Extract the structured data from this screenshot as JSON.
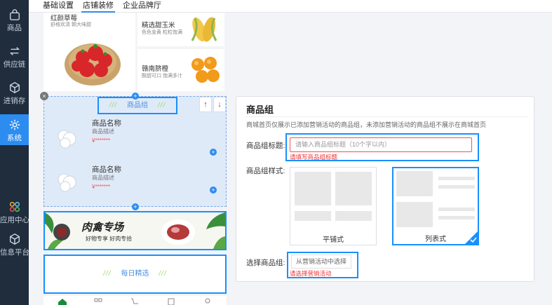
{
  "sidebar": {
    "items": [
      {
        "label": "商品",
        "icon": "shopping-bag-icon"
      },
      {
        "label": "供应链",
        "icon": "exchange-icon"
      },
      {
        "label": "进销存",
        "icon": "inventory-icon"
      },
      {
        "label": "系统",
        "icon": "gear-icon"
      },
      {
        "label": "应用中心",
        "icon": "apps-icon"
      },
      {
        "label": "信息平台",
        "icon": "cube-icon"
      }
    ]
  },
  "tabs": [
    "基础设置",
    "店铺装修",
    "企业品牌厅"
  ],
  "preview": {
    "fruit_left": {
      "name": "红颜草莓",
      "desc": "舒格欢清 颗大味甜"
    },
    "fruit_r1": {
      "name": "精选甜玉米",
      "desc": "色色金黄 粒粒饱满"
    },
    "fruit_r2": {
      "name": "赣南脐橙",
      "desc": "酸甜可口 饱满多汁"
    },
    "goods_group_title": "商品组",
    "deco": "///",
    "items": [
      {
        "name": "商品名称",
        "desc": "商品描述",
        "price": "¥*******"
      },
      {
        "name": "商品名称",
        "desc": "商品描述",
        "price": "¥*******"
      }
    ],
    "banner_title": "肉禽专场",
    "banner_sub": "好物专享 好肉专拾",
    "daily_title": "每日精选",
    "up": "↑",
    "down": "↓",
    "close": "×",
    "plus": "+"
  },
  "panel": {
    "title": "商品组",
    "note": "商城首页仅展示已添加营销活动的商品组，未添加营销活动的商品组不展示在商城首页",
    "title_label": "商品组标题:",
    "title_placeholder": "请输入商品组标题（10个字以内）",
    "title_error": "请填写商品组标题",
    "style_label": "商品组样式:",
    "style_options": [
      {
        "label": "平铺式",
        "selected": false
      },
      {
        "label": "列表式",
        "selected": true
      }
    ],
    "select_label": "选择商品组:",
    "select_button": "从营销活动中选择",
    "select_error": "请选择营销活动"
  },
  "colors": {
    "accent": "#1890ff",
    "sidebar": "#1f2d3d",
    "error": "#e33"
  }
}
